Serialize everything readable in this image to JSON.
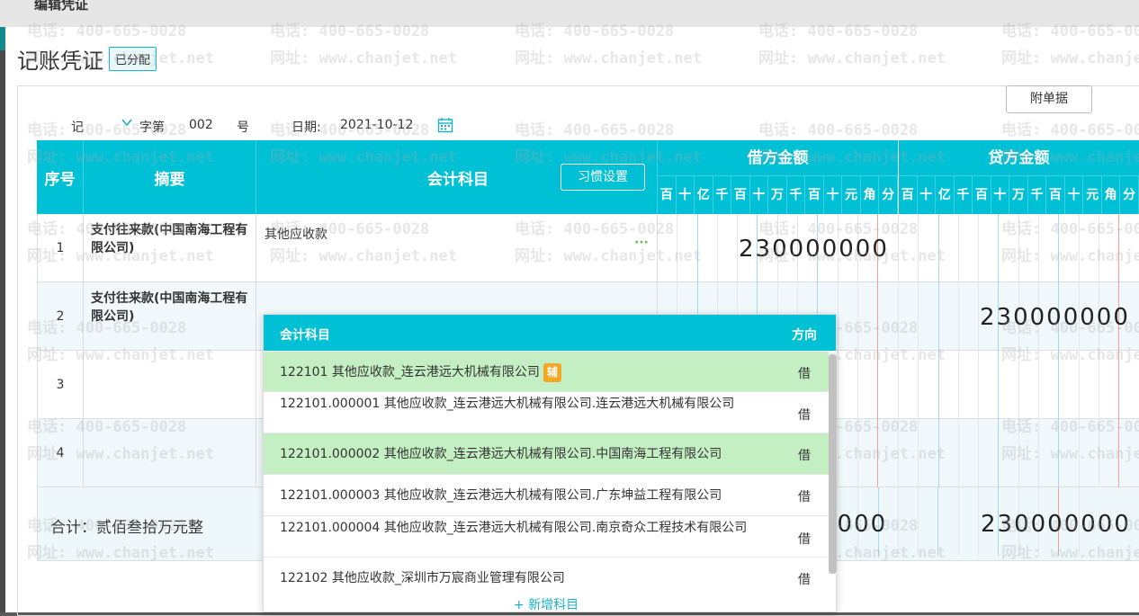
{
  "window": {
    "title": "编辑凭证"
  },
  "voucher": {
    "heading": "记账凭证",
    "status_badge": "已分配",
    "type": "记",
    "type_suffix": "字第",
    "number": "002",
    "number_suffix": "号",
    "date_label": "日期:",
    "date": "2021-10-12",
    "attachments_button": "附单据"
  },
  "table": {
    "headers": {
      "index": "序号",
      "summary": "摘要",
      "account": "会计科目",
      "debit": "借方金额",
      "credit": "贷方金额"
    },
    "habit_button": "习惯设置",
    "digit_units": [
      "百",
      "十",
      "亿",
      "千",
      "百",
      "十",
      "万",
      "千",
      "百",
      "十",
      "元",
      "角",
      "分"
    ],
    "rows": [
      {
        "no": "1",
        "summary": "支付往来款(中国南海工程有限公司)",
        "account": "其他应收款",
        "account_more": "···",
        "debit": "230000000",
        "credit": ""
      },
      {
        "no": "2",
        "summary": "支付往来款(中国南海工程有限公司)",
        "account": "",
        "debit": "",
        "credit": "230000000"
      },
      {
        "no": "3",
        "summary": "",
        "account": "",
        "debit": "",
        "credit": ""
      },
      {
        "no": "4",
        "summary": "",
        "account": "",
        "debit": "",
        "credit": ""
      }
    ],
    "total": {
      "label": "合计：贰佰叁拾万元整",
      "debit_partial": "0000",
      "credit": "230000000"
    }
  },
  "dropdown": {
    "col_account": "会计科目",
    "col_direction": "方向",
    "options": [
      {
        "name": "122101 其他应收款_连云港远大机械有限公司",
        "tag": "辅",
        "direction": "借"
      },
      {
        "name": "122101.000001 其他应收款_连云港远大机械有限公司.连云港远大机械有限公司",
        "direction": "借"
      },
      {
        "name": "122101.000002 其他应收款_连云港远大机械有限公司.中国南海工程有限公司",
        "direction": "借"
      },
      {
        "name": "122101.000003 其他应收款_连云港远大机械有限公司.广东坤益工程有限公司",
        "direction": "借"
      },
      {
        "name": "122101.000004 其他应收款_连云港远大机械有限公司.南京奇众工程技术有限公司",
        "direction": "借"
      },
      {
        "name": "122102 其他应收款_深圳市万宸商业管理有限公司",
        "direction": "借"
      }
    ],
    "add_label": "+ 新增科目"
  },
  "watermark": {
    "phone": "电话: 400-665-0028",
    "site": "网址: www.chanjet.net"
  },
  "colors": {
    "header_teal": "#00c0d6",
    "selected_row": "#c3efc3",
    "tag_orange": "#f5a623"
  }
}
